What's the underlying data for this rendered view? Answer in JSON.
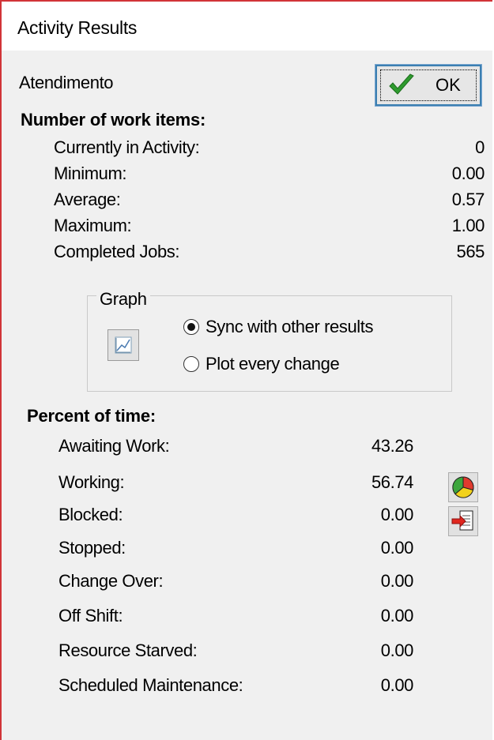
{
  "window": {
    "title": "Activity Results"
  },
  "activity_name": "Atendimento",
  "ok_button": {
    "label": "OK"
  },
  "work_items": {
    "heading": "Number of work items:",
    "rows": [
      {
        "label": "Currently in Activity:",
        "value": "0"
      },
      {
        "label": "Minimum:",
        "value": "0.00"
      },
      {
        "label": "Average:",
        "value": "0.57"
      },
      {
        "label": "Maximum:",
        "value": "1.00"
      },
      {
        "label": "Completed Jobs:",
        "value": "565"
      }
    ]
  },
  "graph": {
    "label": "Graph",
    "options": [
      {
        "label": "Sync with other results",
        "selected": true
      },
      {
        "label": "Plot every change",
        "selected": false
      }
    ]
  },
  "percent_time": {
    "heading": "Percent of time:",
    "rows": [
      {
        "label": "Awaiting Work:",
        "value": "43.26"
      },
      {
        "label": "Working:",
        "value": "56.74"
      },
      {
        "label": "Blocked:",
        "value": "0.00"
      },
      {
        "label": "Stopped:",
        "value": "0.00"
      },
      {
        "label": "Change Over:",
        "value": "0.00"
      },
      {
        "label": "Off Shift:",
        "value": "0.00"
      },
      {
        "label": "Resource Starved:",
        "value": "0.00"
      },
      {
        "label": "Scheduled Maintenance:",
        "value": "0.00"
      }
    ]
  },
  "icons": {
    "ok": "checkmark-icon",
    "graph": "line-graph-icon",
    "pie": "pie-chart-icon",
    "export": "export-icon"
  },
  "colors": {
    "window_border": "#d13438",
    "ok_border": "#3c7fb1",
    "check": "#2e9b2e"
  }
}
